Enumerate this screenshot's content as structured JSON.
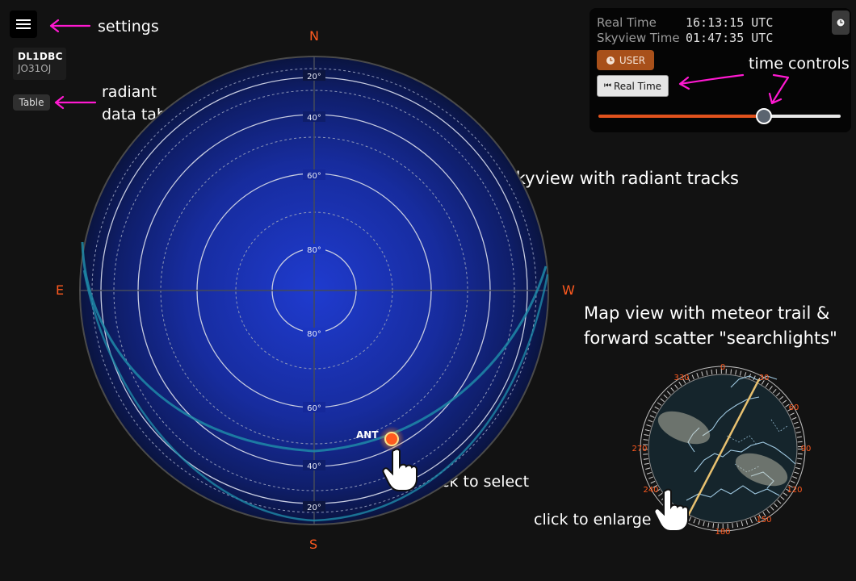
{
  "controls": {
    "menu_icon": "hamburger-icon",
    "station": {
      "callsign": "DL1DBC",
      "locator": "JO31OJ"
    },
    "table_label": "Table"
  },
  "time": {
    "real_time_label": "Real Time",
    "real_time_value": "16:13:15 UTC",
    "skyview_time_label": "Skyview Time",
    "skyview_time_value": "01:47:35 UTC",
    "user_label": "USER",
    "real_time_button": "Real Time",
    "slider_fraction": 0.69,
    "clock_icon": "clock-icon"
  },
  "annotations": {
    "settings": "settings",
    "table_line1": "radiant",
    "table_line2": "data table",
    "time_controls": "time controls",
    "skyview": "Main skyview with radiant tracks",
    "map_line1": "Map view with meteor trail &",
    "map_line2": "forward scatter \"searchlights\"",
    "click_select": "click to select",
    "click_enlarge": "click to enlarge"
  },
  "skyview": {
    "directions": {
      "north": "N",
      "south": "S",
      "east": "E",
      "west": "W"
    },
    "elevation_labels_top": [
      "20°",
      "40°",
      "60°",
      "80°"
    ],
    "elevation_labels_bottom": [
      "80°",
      "60°",
      "40°",
      "20°"
    ],
    "radiant_label": "ANT"
  },
  "minimap": {
    "azimuth_labels": [
      "0",
      "30",
      "60",
      "90",
      "120",
      "150",
      "180",
      "240",
      "270",
      "330"
    ]
  },
  "colors": {
    "background": "#121212",
    "accent_orange": "#ff5a1f",
    "annotation_arrow": "#ff19d1",
    "track": "#1e8aa8",
    "user_button": "#a8501a",
    "slider_fill": "#e0521d"
  }
}
